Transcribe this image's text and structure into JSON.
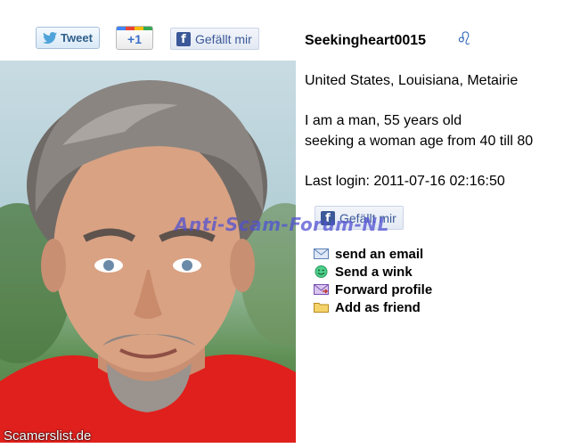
{
  "social": {
    "tweet_label": "Tweet",
    "plus_label": "+1",
    "like_label": "Gefällt mir"
  },
  "profile": {
    "username": "Seekingheart0015",
    "zodiac_symbol": "♌",
    "location": "United States, Louisiana, Metairie",
    "description_line1": "I am a man, 55 years old",
    "description_line2": "seeking a woman age from 40 till 80",
    "last_login": "Last login: 2011-07-16 02:16:50"
  },
  "actions": [
    {
      "label": "send an email",
      "icon": "envelope-icon"
    },
    {
      "label": "Send a wink",
      "icon": "smiley-icon"
    },
    {
      "label": "Forward profile",
      "icon": "forward-envelope-icon"
    },
    {
      "label": "Add as friend",
      "icon": "folder-icon"
    }
  ],
  "watermark": "Anti-Scam-Forum-NL",
  "photo_credit": "Scamerslist.de",
  "colors": {
    "link_blue": "#3b5998",
    "watermark": "#5050d2",
    "shirt_red": "#e0201c"
  }
}
